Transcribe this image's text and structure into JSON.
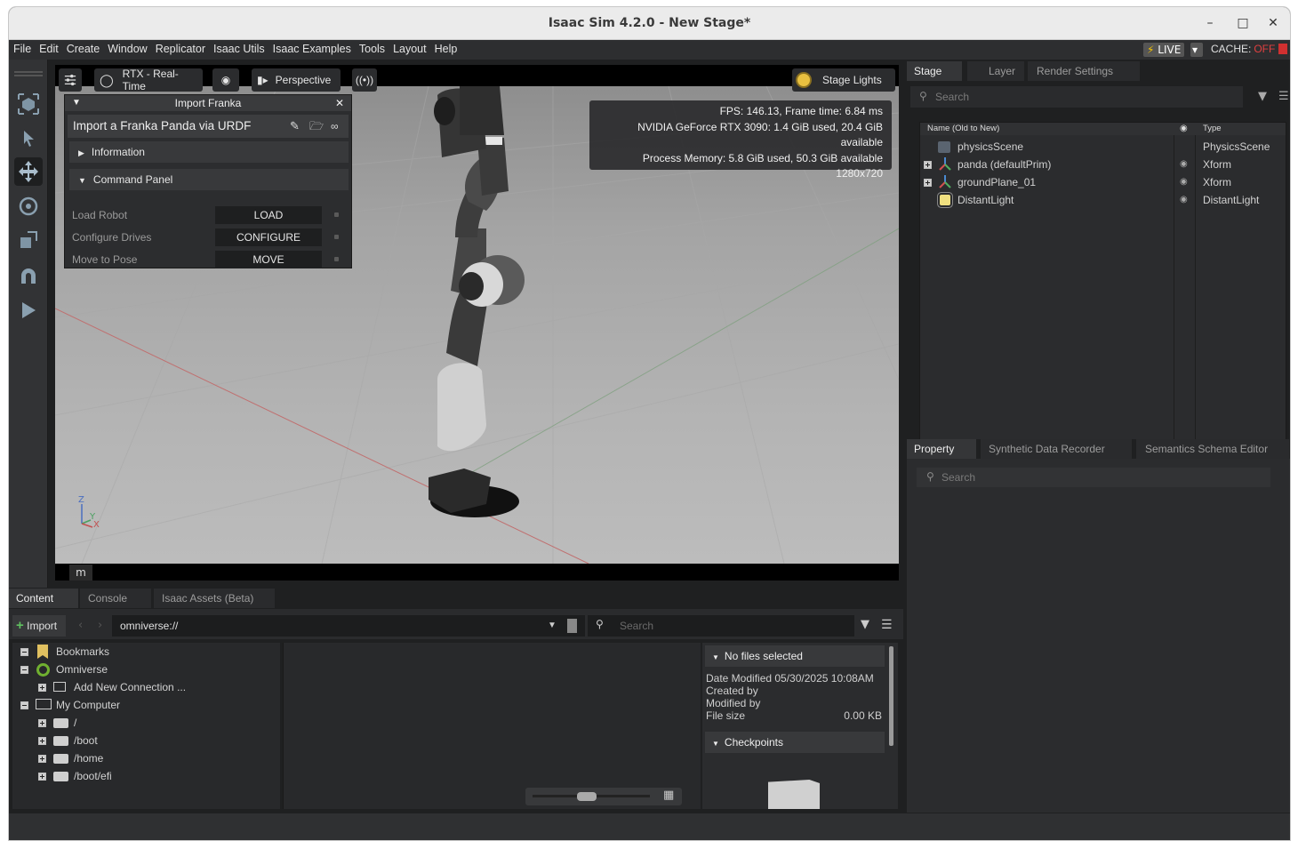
{
  "window": {
    "title": "Isaac Sim 4.2.0 - New Stage*"
  },
  "menu": {
    "items": [
      "File",
      "Edit",
      "Create",
      "Window",
      "Replicator",
      "Isaac Utils",
      "Isaac Examples",
      "Tools",
      "Layout",
      "Help"
    ],
    "live_label": "LIVE",
    "cache_label": "CACHE:",
    "cache_state": "OFF"
  },
  "viewport": {
    "renderer_label": "RTX - Real-Time",
    "camera_label": "Perspective",
    "lights_label": "Stage Lights",
    "stats": [
      "FPS: 146.13, Frame time: 6.84 ms",
      "NVIDIA GeForce RTX 3090: 1.4 GiB used, 20.4 GiB available",
      "Process Memory: 5.8 GiB used, 50.3 GiB available",
      "1280x720"
    ],
    "axis": {
      "z": "Z",
      "y": "Y",
      "x": "X"
    },
    "badge": "m"
  },
  "import_panel": {
    "header": "Import Franka",
    "title": "Import a Franka Panda via URDF",
    "information_label": "Information",
    "command_panel_label": "Command Panel",
    "commands": [
      {
        "label": "Load Robot",
        "button": "LOAD"
      },
      {
        "label": "Configure Drives",
        "button": "CONFIGURE"
      },
      {
        "label": "Move to Pose",
        "button": "MOVE"
      }
    ]
  },
  "stage": {
    "tabs": [
      "Stage",
      "Layer",
      "Render Settings"
    ],
    "search_placeholder": "Search",
    "col_name": "Name (Old to New)",
    "col_type": "Type",
    "rows": [
      {
        "name": "physicsScene",
        "type": "PhysicsScene",
        "expand": false,
        "visible": false,
        "icon": "physics-scene-icon"
      },
      {
        "name": "panda (defaultPrim)",
        "type": "Xform",
        "expand": true,
        "visible": true,
        "icon": "xform-icon"
      },
      {
        "name": "groundPlane_01",
        "type": "Xform",
        "expand": true,
        "visible": true,
        "icon": "xform-icon"
      },
      {
        "name": "DistantLight",
        "type": "DistantLight",
        "expand": false,
        "visible": true,
        "icon": "light-icon"
      }
    ]
  },
  "property": {
    "tabs": [
      "Property",
      "Synthetic Data Recorder",
      "Semantics Schema Editor"
    ],
    "search_placeholder": "Search"
  },
  "content": {
    "tabs": [
      "Content",
      "Console",
      "Isaac Assets (Beta)"
    ],
    "import_label": "Import",
    "path_value": "omniverse://",
    "search_placeholder": "Search",
    "tree": [
      {
        "label": "Bookmarks",
        "level": 0,
        "toggle": "minus",
        "icon": "bookmark-icon"
      },
      {
        "label": "Omniverse",
        "level": 0,
        "toggle": "minus",
        "icon": "omniverse-icon"
      },
      {
        "label": "Add New Connection ...",
        "level": 1,
        "toggle": "plus",
        "icon": "add-connection-icon"
      },
      {
        "label": "My Computer",
        "level": 0,
        "toggle": "minus",
        "icon": "computer-icon"
      },
      {
        "label": "/",
        "level": 1,
        "toggle": "plus",
        "icon": "drive-icon"
      },
      {
        "label": "/boot",
        "level": 1,
        "toggle": "plus",
        "icon": "drive-icon"
      },
      {
        "label": "/home",
        "level": 1,
        "toggle": "plus",
        "icon": "drive-icon"
      },
      {
        "label": "/boot/efi",
        "level": 1,
        "toggle": "plus",
        "icon": "drive-icon"
      }
    ],
    "details": {
      "no_files": "No files selected",
      "date_modified": "Date Modified 05/30/2025 10:08AM",
      "created_by": "Created by",
      "modified_by": "Modified by",
      "file_size_label": "File size",
      "file_size_value": "0.00 KB",
      "checkpoints": "Checkpoints"
    }
  }
}
